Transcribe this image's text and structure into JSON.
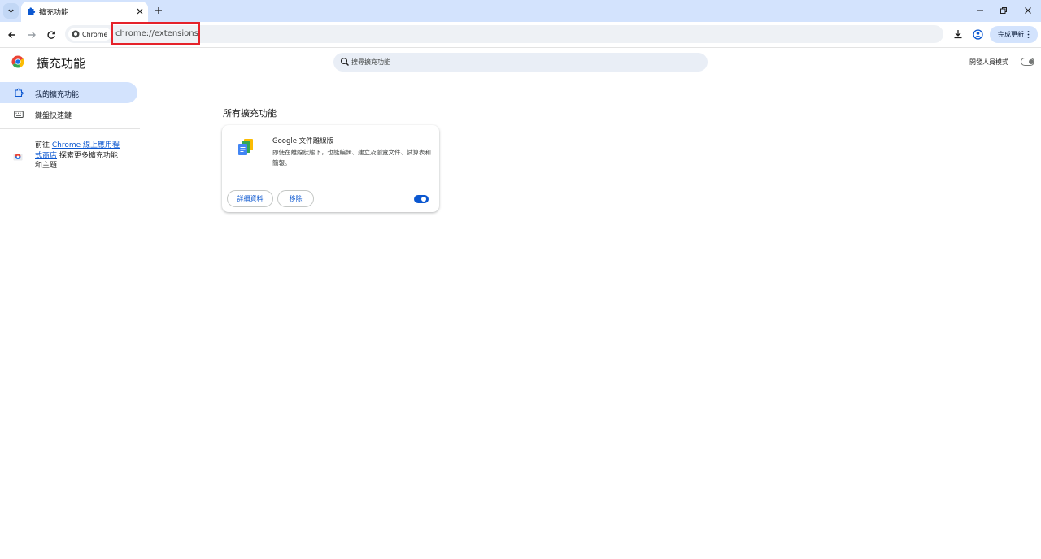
{
  "tab": {
    "title": "擴充功能"
  },
  "omnibox": {
    "chip_label": "Chrome",
    "url": "chrome://extensions"
  },
  "toolbar": {
    "update_label": "完成更新"
  },
  "page": {
    "title": "擴充功能",
    "search_placeholder": "搜尋擴充功能",
    "developer_mode_label": "開發人員模式",
    "developer_mode_on": false
  },
  "sidebar": {
    "items": [
      {
        "label": "我的擴充功能",
        "active": true
      },
      {
        "label": "鍵盤快速鍵",
        "active": false
      }
    ],
    "store_prefix": "前往 ",
    "store_link": "Chrome 線上應用程式商店",
    "store_suffix": " 探索更多擴充功能和主題"
  },
  "main": {
    "section_title": "所有擴充功能",
    "extensions": [
      {
        "name": "Google 文件離線版",
        "description": "即使在離線狀態下，也能編輯、建立及瀏覽文件、試算表和簡報。",
        "details_label": "詳細資料",
        "remove_label": "移除",
        "enabled": true
      }
    ]
  },
  "colors": {
    "accent": "#0b57d0",
    "tabstrip_bg": "#d3e3fd",
    "highlight_box": "#e5222a"
  }
}
